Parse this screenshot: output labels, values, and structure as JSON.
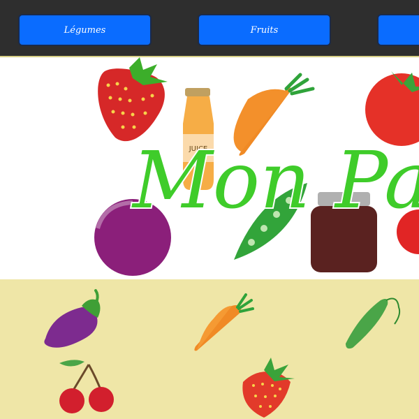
{
  "nav": {
    "buttons": [
      {
        "label": "Légumes"
      },
      {
        "label": "Fruits"
      },
      {
        "label": ""
      }
    ]
  },
  "banner": {
    "logo_text": "Mon Par",
    "jar_label": "JUICE"
  },
  "grid": {
    "items": [
      {
        "icon": "eggplant-icon"
      },
      {
        "icon": "carrot-icon"
      },
      {
        "icon": "cucumber-icon"
      },
      {
        "icon": "cherry-icon"
      },
      {
        "icon": "strawberry-icon"
      }
    ]
  },
  "colors": {
    "navbar": "#2e2e2e",
    "button": "#0a6cff",
    "grid_bg": "#efe6a7",
    "logo_green": "#3fcc2a"
  }
}
